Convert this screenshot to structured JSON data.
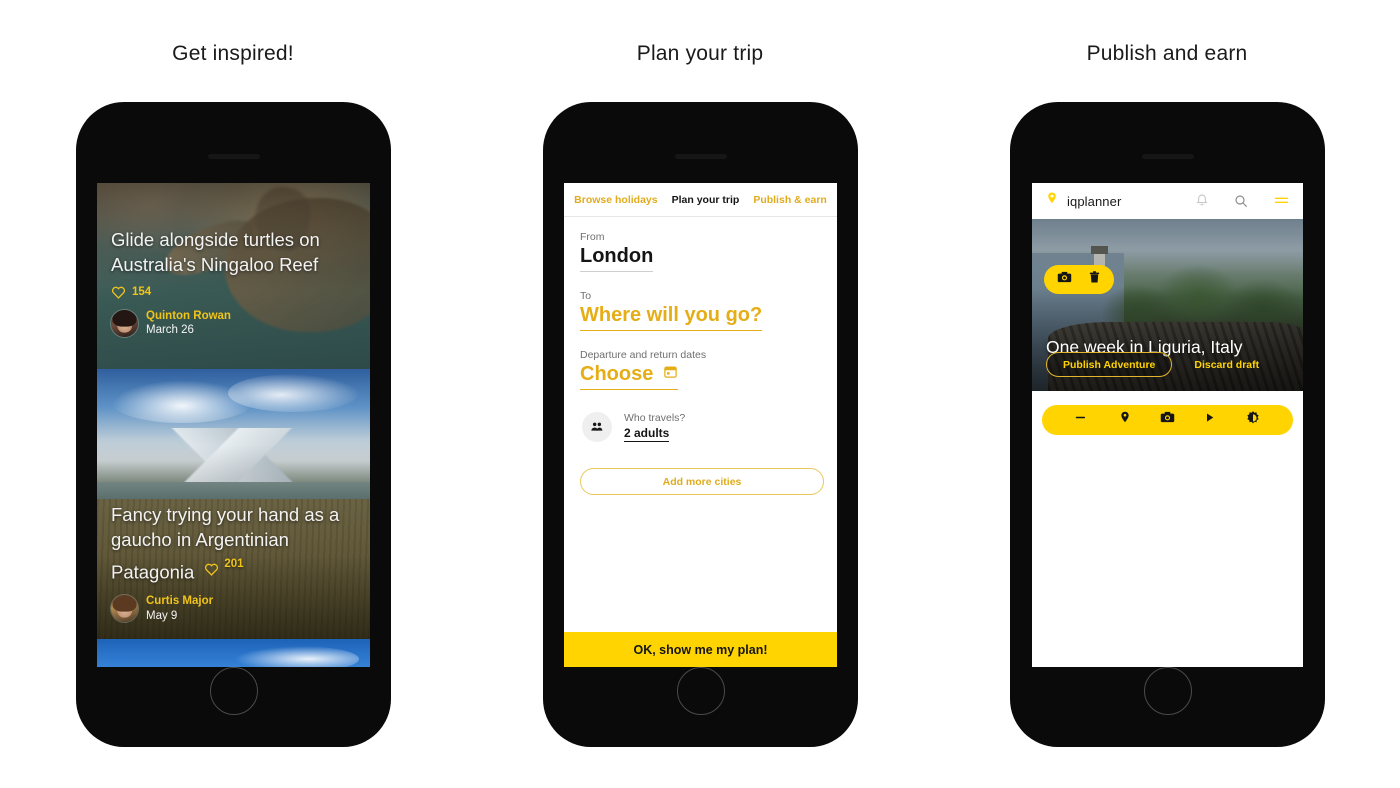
{
  "columns": [
    {
      "title": "Get inspired!"
    },
    {
      "title": "Plan your trip"
    },
    {
      "title": "Publish and earn"
    }
  ],
  "feed": {
    "cards": [
      {
        "title": "Glide alongside turtles on Australia's Ningaloo Reef",
        "likes": "154",
        "author": "Quinton Rowan",
        "date": "March 26",
        "image_alt": "sea-turtle-underwater"
      },
      {
        "title": "Fancy trying your hand as a gaucho in Argentinian Patagonia",
        "likes": "201",
        "author": "Curtis Major",
        "date": "May 9",
        "image_alt": "patagonia-mountains-grassland"
      },
      {
        "title": "",
        "likes": "",
        "author": "",
        "date": "",
        "image_alt": "blue-sky-clouds"
      }
    ]
  },
  "planner": {
    "tabs": [
      {
        "label": "Browse holidays",
        "active": false
      },
      {
        "label": "Plan your trip",
        "active": true
      },
      {
        "label": "Publish & earn",
        "active": false
      }
    ],
    "from_label": "From",
    "from_value": "London",
    "to_label": "To",
    "to_placeholder": "Where will you go?",
    "dates_label": "Departure and return dates",
    "dates_value": "Choose",
    "calendar_icon": "calendar-icon",
    "travelers_icon": "people-icon",
    "travelers_question": "Who travels?",
    "travelers_value": "2 adults",
    "add_cities_label": "Add more cities",
    "cta_label": "OK, show me my plan!"
  },
  "publisher": {
    "logo_icon": "map-pin-icon",
    "logo_text": "iqplanner",
    "header_icons": [
      "bell-icon",
      "search-icon",
      "hamburger-menu-icon"
    ],
    "hero_tools": [
      "camera-icon",
      "trash-icon"
    ],
    "hero_title": "One week in Liguria, Italy",
    "publish_label": "Publish Adventure",
    "discard_label": "Discard draft",
    "toolbar_icons": [
      "text-icon",
      "location-pin-icon",
      "camera-icon",
      "video-play-icon",
      "brightness-icon"
    ],
    "image_alt": "liguria-lighthouse-coast"
  },
  "colors": {
    "accent_yellow": "#ffd400",
    "accent_gold": "#e0ac1e",
    "like_yellow": "#f0c419",
    "text_dark": "#151515",
    "device_black": "#0a0a0a"
  }
}
